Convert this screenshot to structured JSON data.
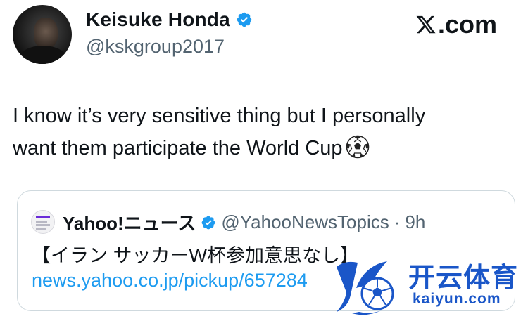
{
  "tweet": {
    "author": {
      "display_name": "Keisuke Honda",
      "handle": "@kskgroup2017",
      "verified": true
    },
    "site_label": "X.com",
    "site_label_suffix": ".com",
    "text_line1": "I know it’s very sensitive thing but I personally",
    "text_line2": "want them participate the World Cup",
    "emoji": "soccer-ball-icon"
  },
  "quote": {
    "author": {
      "display_name": "Yahoo!ニュース",
      "handle": "@YahooNewsTopics",
      "verified": true
    },
    "separator": "·",
    "time": "9h",
    "text": "【イラン サッカーW杯参加意思なし】",
    "link": "news.yahoo.co.jp/pickup/657284"
  },
  "watermark": {
    "title": "开云体育",
    "subtitle": "kaiyun.com"
  },
  "colors": {
    "verified": "#1d9bf0",
    "link": "#1d9bf0",
    "secondary_text": "#536471",
    "border": "#cfd9de",
    "watermark": "#1a56c8"
  }
}
